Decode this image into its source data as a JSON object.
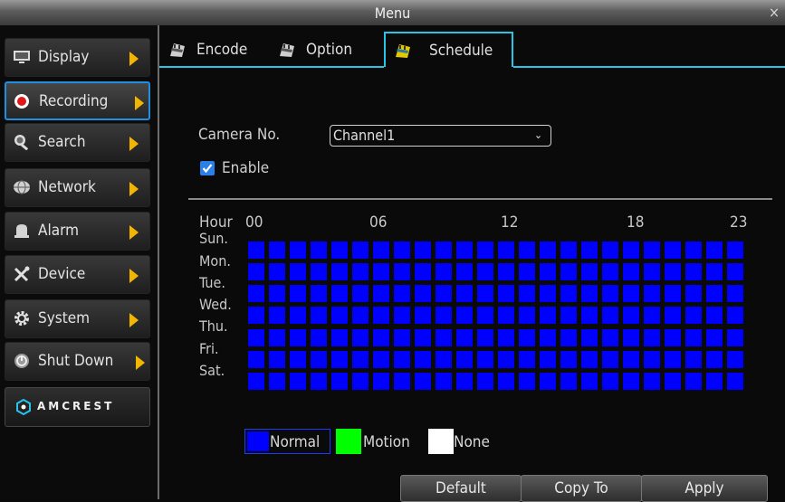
{
  "window": {
    "title": "Menu",
    "close": "×"
  },
  "sidebar": {
    "items": [
      {
        "label": "Display",
        "icon": "monitor-icon"
      },
      {
        "label": "Recording",
        "icon": "record-icon",
        "active": true
      },
      {
        "label": "Search",
        "icon": "magnifier-icon"
      },
      {
        "label": "Network",
        "icon": "globe-icon"
      },
      {
        "label": "Alarm",
        "icon": "bell-icon"
      },
      {
        "label": "Device",
        "icon": "tools-icon"
      },
      {
        "label": "System",
        "icon": "gear-icon"
      },
      {
        "label": "Shut Down",
        "icon": "power-icon"
      }
    ],
    "logo": "AMCREST"
  },
  "tabs": [
    {
      "label": "Encode"
    },
    {
      "label": "Option"
    },
    {
      "label": "Schedule",
      "selected": true
    }
  ],
  "form": {
    "camera_label": "Camera No.",
    "camera_value": "Channel1",
    "enable_label": "Enable",
    "enable_checked": true
  },
  "schedule": {
    "hour_label": "Hour",
    "hour_marks": [
      "00",
      "06",
      "12",
      "18",
      "23"
    ],
    "days": [
      "Sun.",
      "Mon.",
      "Tue.",
      "Wed.",
      "Thu.",
      "Fri.",
      "Sat."
    ],
    "hours_per_day": 24,
    "fill_mode": "Normal"
  },
  "legend": [
    {
      "label": "Normal",
      "color": "#0000ff",
      "selected": true
    },
    {
      "label": "Motion",
      "color": "#00ff00"
    },
    {
      "label": "None",
      "color": "#ffffff"
    }
  ],
  "buttons": {
    "default": "Default",
    "copy_to": "Copy To",
    "apply": "Apply"
  },
  "colors": {
    "accent": "#27c6e8",
    "arrow": "#f2b600",
    "active_border": "#1f8fe0"
  }
}
